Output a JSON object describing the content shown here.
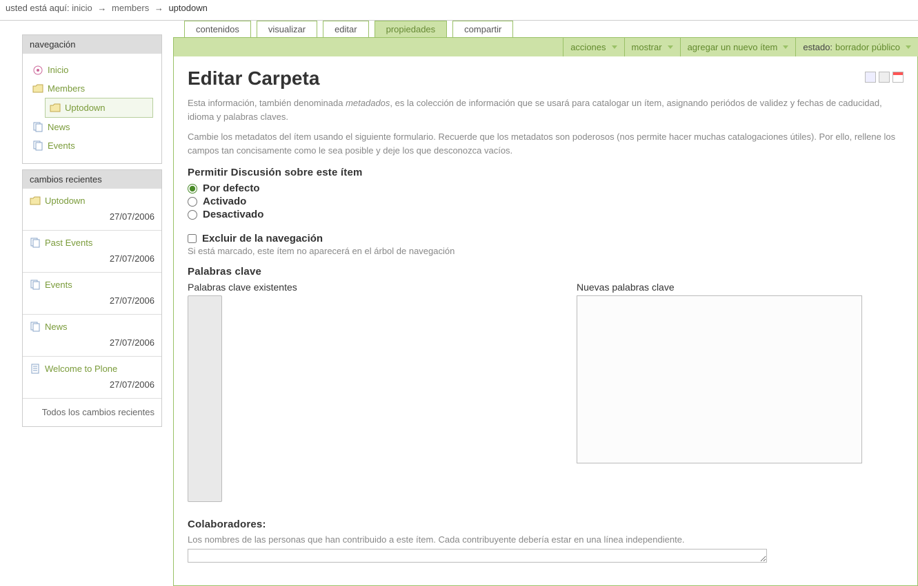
{
  "breadcrumb": {
    "label": "usted está aquí:",
    "items": [
      "inicio",
      "members",
      "uptodown"
    ]
  },
  "sidebar": {
    "nav_title": "navegación",
    "nav": {
      "inicio": "Inicio",
      "members": "Members",
      "uptodown": "Uptodown",
      "news": "News",
      "events": "Events"
    },
    "recent_title": "cambios recientes",
    "recent": [
      {
        "title": "Uptodown",
        "date": "27/07/2006",
        "icon": "folder"
      },
      {
        "title": "Past Events",
        "date": "27/07/2006",
        "icon": "multi"
      },
      {
        "title": "Events",
        "date": "27/07/2006",
        "icon": "multi"
      },
      {
        "title": "News",
        "date": "27/07/2006",
        "icon": "multi"
      },
      {
        "title": "Welcome to Plone",
        "date": "27/07/2006",
        "icon": "page"
      }
    ],
    "recent_footer": "Todos los cambios recientes"
  },
  "tabs": {
    "contenidos": "contenidos",
    "visualizar": "visualizar",
    "editar": "editar",
    "propiedades": "propiedades",
    "compartir": "compartir"
  },
  "actions": {
    "acciones": "acciones",
    "mostrar": "mostrar",
    "agregar": "agregar un nuevo ítem",
    "estado_label": "estado:",
    "estado_value": "borrador público"
  },
  "content": {
    "title": "Editar Carpeta",
    "desc1a": "Esta información, también denominada ",
    "desc1b": "metadados",
    "desc1c": ", es la colección de información que se usará para catalogar un ítem, asignando periódos de validez y fechas de caducidad, idioma y palabras claves.",
    "desc2": "Cambie los metadatos del ítem usando el siguiente formulario. Recuerde que los metadatos son poderosos (nos permite hacer muchas catalogaciones útiles). Por ello, rellene los campos tan concisamente como le sea posible y deje los que desconozca vacíos.",
    "discussion_title": "Permitir Discusión sobre este ítem",
    "radio_default": "Por defecto",
    "radio_on": "Activado",
    "radio_off": "Desactivado",
    "exclude_label": "Excluir de la navegación",
    "exclude_help": "Si está marcado, este ítem no aparecerá en el árbol de navegación",
    "keywords_title": "Palabras clave",
    "keywords_existing": "Palabras clave existentes",
    "keywords_new": "Nuevas palabras clave",
    "contributors_title": "Colaboradores:",
    "contributors_help": "Los nombres de las personas que han contribuido a este ítem. Cada contribuyente debería estar en una línea independiente."
  }
}
